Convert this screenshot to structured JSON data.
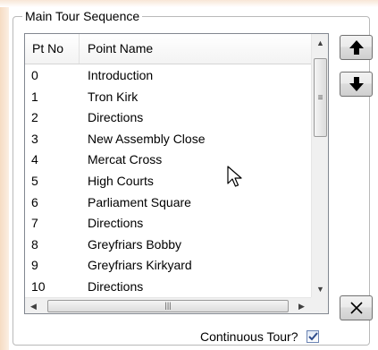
{
  "groupbox": {
    "title": "Main Tour Sequence"
  },
  "list": {
    "columns": {
      "pt_no": "Pt No",
      "point_name": "Point Name"
    },
    "rows": [
      {
        "no": "0",
        "name": "Introduction"
      },
      {
        "no": "1",
        "name": "Tron Kirk"
      },
      {
        "no": "2",
        "name": "Directions"
      },
      {
        "no": "3",
        "name": "New Assembly Close"
      },
      {
        "no": "4",
        "name": "Mercat Cross"
      },
      {
        "no": "5",
        "name": "High Courts"
      },
      {
        "no": "6",
        "name": "Parliament Square"
      },
      {
        "no": "7",
        "name": "Directions"
      },
      {
        "no": "8",
        "name": "Greyfriars Bobby"
      },
      {
        "no": "9",
        "name": "Greyfriars Kirkyard"
      },
      {
        "no": "10",
        "name": "Directions"
      }
    ]
  },
  "buttons": {
    "move_up_icon": "arrow-up-icon",
    "move_down_icon": "arrow-down-icon",
    "delete_icon": "close-icon"
  },
  "continuous": {
    "label": "Continuous Tour?",
    "checked": true
  },
  "colors": {
    "check_mark": "#2d4c8c",
    "border": "#828790"
  }
}
